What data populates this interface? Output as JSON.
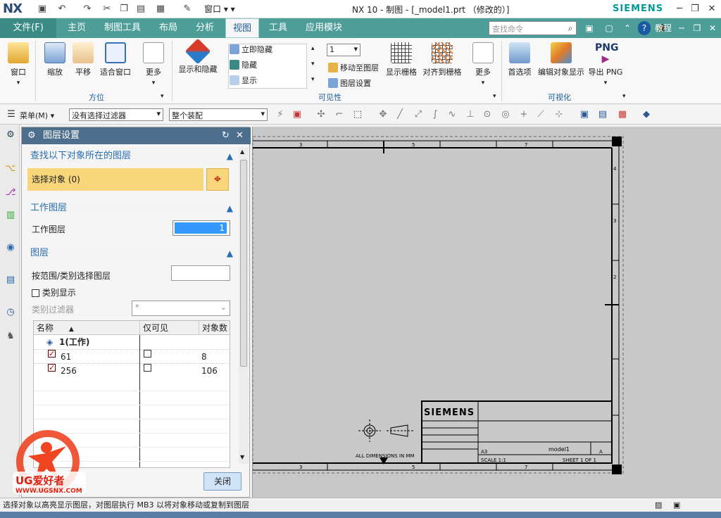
{
  "app": {
    "logo": "NX",
    "title": "NX 10 - 制图 - [_model1.prt （修改的）]",
    "brand": "SIEMENS",
    "window_menu": "窗口 ▾ ▾"
  },
  "tabs": {
    "file": "文件(F)",
    "items": [
      "主页",
      "制图工具",
      "布局",
      "分析",
      "视图",
      "工具",
      "应用模块"
    ],
    "active": "视图",
    "search_placeholder": "查找命令",
    "right_items": [
      "教程"
    ]
  },
  "ribbon": {
    "orient": {
      "label": "方位",
      "buttons": [
        "窗口",
        "缩放",
        "平移",
        "适合窗口",
        "更多"
      ]
    },
    "visibility": {
      "label": "可见性",
      "show_hide": "显示和隐藏",
      "small": [
        "立即隐藏",
        "隐藏",
        "显示"
      ],
      "layer_value": "1",
      "move_to_layer": "移动至图层",
      "layer_settings": "图层设置",
      "show_grid": "显示栅格",
      "snap_grid": "对齐到栅格",
      "more": "更多"
    },
    "visualize": {
      "label": "可视化",
      "buttons": [
        "首选项",
        "编辑对象显示",
        "导出 PNG"
      ],
      "png_tag": "PNG"
    },
    "colors": {
      "tab_bg": "#4d9e99",
      "accent": "#1a5a9a"
    }
  },
  "toolbar": {
    "menu": "菜单(M) ▾",
    "filter": "没有选择过滤器",
    "scope": "整个装配"
  },
  "dialog": {
    "title": "图层设置",
    "section1": "查找以下对象所在的图层",
    "select_objects": "选择对象 (0)",
    "section2": "工作图层",
    "work_layer_label": "工作图层",
    "work_layer_value": "1",
    "section3": "图层",
    "range_label": "按范围/类别选择图层",
    "category_display": "类别显示",
    "category_filter_label": "类别过滤器",
    "category_filter_value": "*",
    "table": {
      "headers": [
        "名称",
        "仅可见",
        "对象数"
      ],
      "group": "1(工作)",
      "rows": [
        {
          "name": "61",
          "count": "8"
        },
        {
          "name": "256",
          "count": "106"
        }
      ]
    },
    "close": "关闭"
  },
  "drawing": {
    "brand": "SIEMENS",
    "dimensions_note": "ALL DIMENSIONS IN MM",
    "name": "model1",
    "scale": "SCALE 1:1",
    "sheet": "SHEET 1 OF 1",
    "size": "A3",
    "rev": "A",
    "border_numbers_top": [
      "3",
      "5",
      "7"
    ],
    "border_numbers_right": [
      "4",
      "3",
      "2"
    ]
  },
  "status": {
    "text": "选择对象以高亮显示图层，对图层执行 MB3 以将对象移动或复制到图层"
  },
  "watermark": {
    "brand": "UG爱好者",
    "url": "WWW.UGSNX.COM"
  }
}
